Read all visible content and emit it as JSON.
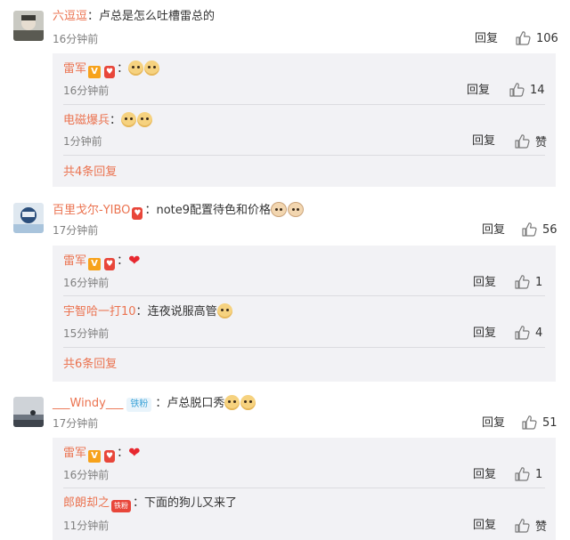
{
  "colors": {
    "username": "#eb7350",
    "reply_bg": "#f2f2f5",
    "time": "#808080"
  },
  "comments": [
    {
      "user": "六逗逗",
      "sep": "：",
      "text": "卢总是怎么吐槽雷总的",
      "time": "16分钟前",
      "reply_label": "回复",
      "likes": "106",
      "replies": [
        {
          "user": "雷军",
          "sep": "：",
          "text": "",
          "time": "16分钟前",
          "reply_label": "回复",
          "likes": "14"
        },
        {
          "user": "电磁爆兵",
          "sep": "：",
          "text": "",
          "time": "1分钟前",
          "reply_label": "回复",
          "likes": "赞"
        }
      ],
      "more": "共4条回复"
    },
    {
      "user": "百里戈尔-YIBO",
      "sep": "：",
      "text": "note9配置待色和价格",
      "time": "17分钟前",
      "reply_label": "回复",
      "likes": "56",
      "replies": [
        {
          "user": "雷军",
          "sep": "：",
          "text": "",
          "time": "16分钟前",
          "reply_label": "回复",
          "likes": "1"
        },
        {
          "user": "宇智哈一打10",
          "sep": "：",
          "text": "连夜说服高管",
          "time": "15分钟前",
          "reply_label": "回复",
          "likes": "4"
        }
      ],
      "more": "共6条回复"
    },
    {
      "user": "___Windy___",
      "badge": "铁粉",
      "sep": "：",
      "text": "卢总脱口秀",
      "time": "17分钟前",
      "reply_label": "回复",
      "likes": "51",
      "replies": [
        {
          "user": "雷军",
          "sep": "：",
          "text": "",
          "time": "16分钟前",
          "reply_label": "回复",
          "likes": "1"
        },
        {
          "user": "郎朗却之",
          "badge": "铁粉",
          "sep": "：",
          "text": "下面的狗儿又来了",
          "time": "11分钟前",
          "reply_label": "回复",
          "likes": "赞"
        }
      ]
    }
  ],
  "icons": {
    "thumb": "thumbs-up-icon",
    "verified": "verified-v-icon",
    "fan": "fan-badge-icon",
    "heart": "heart-emoji",
    "dog": "doge-emoji",
    "cat": "cat-emoji"
  }
}
